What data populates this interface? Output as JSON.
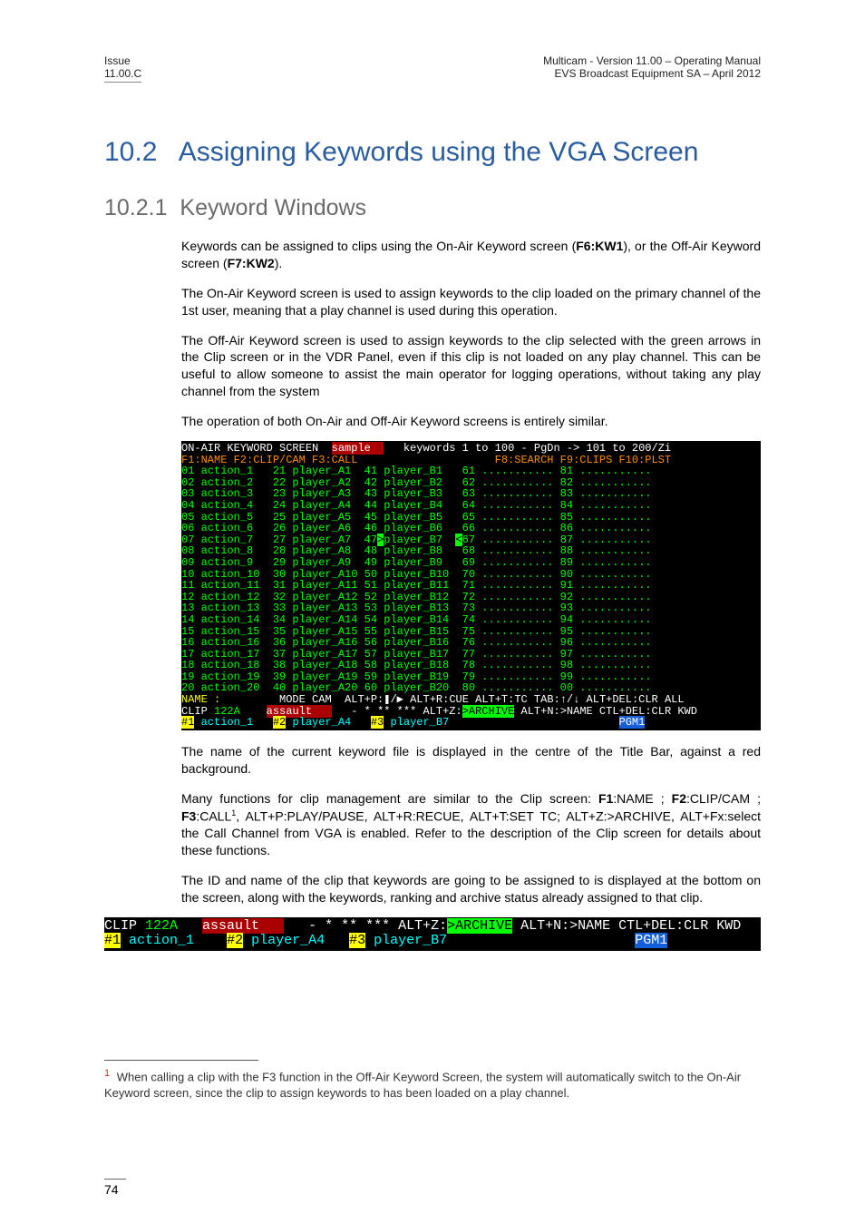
{
  "header": {
    "issue_line1": "Issue",
    "issue_line2": "11.00.C",
    "title_line1": "Multicam - Version 11.00 – Operating Manual",
    "title_line2": "EVS Broadcast Equipment SA – April 2012"
  },
  "section": {
    "number": "10.2",
    "title": "Assigning Keywords using the VGA Screen"
  },
  "subsection": {
    "number": "10.2.1",
    "title": "Keyword Windows"
  },
  "paragraphs": {
    "p1a": "Keywords can be assigned to clips using the On-Air Keyword screen (",
    "p1b": "F6:KW1",
    "p1c": "), or the Off-Air Keyword screen (",
    "p1d": "F7:KW2",
    "p1e": ").",
    "p2": "The On-Air Keyword screen is used to assign keywords to the clip loaded on the primary channel of the 1st user, meaning that a play channel is used during this operation.",
    "p3": "The Off-Air Keyword screen is used to assign keywords to the clip selected with the green arrows in the Clip screen or in the VDR Panel, even if this clip is not loaded on any play channel. This can be useful to allow someone to assist the main operator for logging operations, without taking any play channel from the system",
    "p4": "The operation of both On-Air and Off-Air Keyword screens is entirely similar.",
    "p5": "The name of the current keyword file is displayed in the centre of the Title Bar, against a red background.",
    "p6a": "Many functions for clip management are similar to the Clip screen: ",
    "p6b": "F1",
    "p6c": ":NAME ; ",
    "p6d": "F2",
    "p6e": ":CLIP/CAM ; ",
    "p6f": "F3",
    "p6g": ":CALL",
    "p6h": ", ALT+P:PLAY/PAUSE, ALT+R:RECUE, ALT+T:SET TC; ALT+Z:>ARCHIVE, ALT+Fx:select the Call Channel from VGA is enabled. Refer to the description of the Clip screen for details about these functions.",
    "p7": "The ID and name of the clip that keywords are going to be assigned to is displayed at the bottom on the screen, along with the keywords, ranking and archive status already assigned to that clip."
  },
  "terminal_main": {
    "title_left": "ON-AIR KEYWORD SCREEN",
    "title_mid": "sample",
    "title_right": "keywords 1 to 100 - PgDn -> 101 to 200/Zi",
    "fkeys_left": "F1:NAME F2:CLIP/CAM F3:CALL",
    "fkeys_right": "F8:SEARCH F9:CLIPS F10:PLST",
    "cols": [
      [
        "01 action_1",
        "02 action_2",
        "03 action_3",
        "04 action_4",
        "05 action_5",
        "06 action_6",
        "07 action_7",
        "08 action_8",
        "09 action_9",
        "10 action_10",
        "11 action_11",
        "12 action_12",
        "13 action_13",
        "14 action_14",
        "15 action_15",
        "16 action_16",
        "17 action_17",
        "18 action_18",
        "19 action_19",
        "20 action_20"
      ],
      [
        "21 player_A1",
        "22 player_A2",
        "23 player_A3",
        "24 player_A4",
        "25 player_A5",
        "26 player_A6",
        "27 player_A7",
        "28 player_A8",
        "29 player_A9",
        "30 player_A10",
        "31 player_A11",
        "32 player_A12",
        "33 player_A13",
        "34 player_A14",
        "35 player_A15",
        "36 player_A16",
        "37 player_A17",
        "38 player_A18",
        "39 player_A19",
        "40 player_A20"
      ],
      [
        "41 player_B1",
        "42 player_B2",
        "43 player_B3",
        "44 player_B4",
        "45 player_B5",
        "46 player_B6",
        "47 player_B7",
        "48 player_B8",
        "49 player_B9",
        "50 player_B10",
        "51 player_B11",
        "52 player_B12",
        "53 player_B13",
        "54 player_B14",
        "55 player_B15",
        "56 player_B16",
        "57 player_B17",
        "58 player_B18",
        "59 player_B19",
        "60 player_B20"
      ],
      [
        "61",
        "62",
        "63",
        "64",
        "65",
        "66",
        "67",
        "68",
        "69",
        "70",
        "71",
        "72",
        "73",
        "74",
        "75",
        "76",
        "77",
        "78",
        "79",
        "80"
      ],
      [
        "81",
        "82",
        "83",
        "84",
        "85",
        "86",
        "87",
        "88",
        "89",
        "90",
        "91",
        "92",
        "93",
        "94",
        "95",
        "96",
        "97",
        "98",
        "99",
        "00"
      ]
    ],
    "bottom_name": "NAME :",
    "bottom_mode": "MODE CAM",
    "bottom_shortcuts": "ALT+P:❚/▶ ALT+R:CUE ALT+T:TC TAB:↑/↓ ALT+DEL:CLR ALL",
    "clip_row_left": "CLIP 122A",
    "clip_row_name": "assault",
    "clip_row_stars": "- * ** ***",
    "clip_row_archive": "ALT+Z:>ARCHIVE",
    "clip_row_right": "ALT+N:>NAME CTL+DEL:CLR KWD",
    "assigned_row_1": "#1",
    "assigned_row_1b": "action_1",
    "assigned_row_2": "#2",
    "assigned_row_2b": "player_A4",
    "assigned_row_3": "#3",
    "assigned_row_3b": "player_B7",
    "assigned_row_pgm": "PGM1"
  },
  "terminal_small": {
    "row1_left": "CLIP 122A",
    "row1_name": "assault",
    "row1_stars": "- * ** ***",
    "row1_archive_k": "ALT+Z:",
    "row1_archive_v": ">ARCHIVE",
    "row1_right": "ALT+N:>NAME CTL+DEL:CLR KWD",
    "row2_1a": "#1",
    "row2_1b": "action_1",
    "row2_2a": "#2",
    "row2_2b": "player_A4",
    "row2_3a": "#3",
    "row2_3b": "player_B7",
    "row2_pgm": "PGM1"
  },
  "footnote": {
    "num": "1",
    "text": "When calling a clip with the F3 function in the Off-Air Keyword Screen, the system will automatically switch to the On-Air Keyword screen, since the clip to assign keywords to has been loaded on a play channel."
  },
  "page_number": "74"
}
